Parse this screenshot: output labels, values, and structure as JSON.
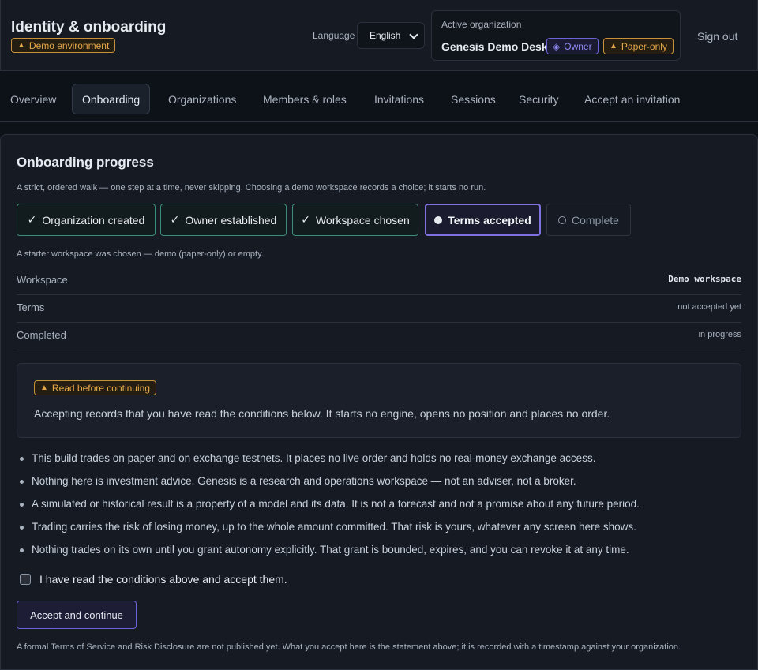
{
  "header": {
    "title": "Identity & onboarding",
    "env_badge": "Demo environment",
    "language_label": "Language",
    "language_value": "English",
    "org_label": "Active organization",
    "org_name": "Genesis Demo Desk",
    "role_badge": "Owner",
    "mode_badge": "Paper-only",
    "sign_out": "Sign out"
  },
  "nav": {
    "tabs": [
      "Overview",
      "Onboarding",
      "Organizations",
      "Members & roles",
      "Invitations",
      "Sessions",
      "Security",
      "Accept an invitation"
    ],
    "active": "Onboarding"
  },
  "main": {
    "title": "Onboarding progress",
    "intro": "A strict, ordered walk — one step at a time, never skipping. Choosing a demo workspace records a choice; it starts no run.",
    "steps": [
      {
        "label": "Organization created",
        "state": "done",
        "icon": "check-icon"
      },
      {
        "label": "Owner established",
        "state": "done",
        "icon": "check-icon"
      },
      {
        "label": "Workspace chosen",
        "state": "done",
        "icon": "check-icon"
      },
      {
        "label": "Terms accepted",
        "state": "current",
        "icon": "filled-dot-icon"
      },
      {
        "label": "Complete",
        "state": "todo",
        "icon": "empty-dot-icon"
      }
    ],
    "step_note": "A starter workspace was chosen — demo (paper-only) or empty.",
    "details": [
      {
        "key": "Workspace",
        "value": "Demo workspace"
      },
      {
        "key": "Terms",
        "value": "not accepted yet"
      },
      {
        "key": "Completed",
        "value": "in progress"
      }
    ],
    "notice": {
      "badge": "Read before continuing",
      "text": "Accepting records that you have read the conditions below. It starts no engine, opens no position and places no order."
    },
    "conditions": [
      "This build trades on paper and on exchange testnets. It places no live order and holds no real-money exchange access.",
      "Nothing here is investment advice. Genesis is a research and operations workspace — not an adviser, not a broker.",
      "A simulated or historical result is a property of a model and its data. It is not a forecast and not a promise about any future period.",
      "Trading carries the risk of losing money, up to the whole amount committed. That risk is yours, whatever any screen here shows.",
      "Nothing trades on its own until you grant autonomy explicitly. That grant is bounded, expires, and you can revoke it at any time."
    ],
    "checkbox_label": "I have read the conditions above and accept them.",
    "accept_button": "Accept and continue",
    "footnote": "A formal Terms of Service and Risk Disclosure are not published yet. What you accept here is the statement above; it is recorded with a timestamp against your organization."
  },
  "colors": {
    "accent": "#7f72e0",
    "done": "#3b8f7a",
    "warning": "#e6a94a",
    "background": "#0d1118"
  }
}
